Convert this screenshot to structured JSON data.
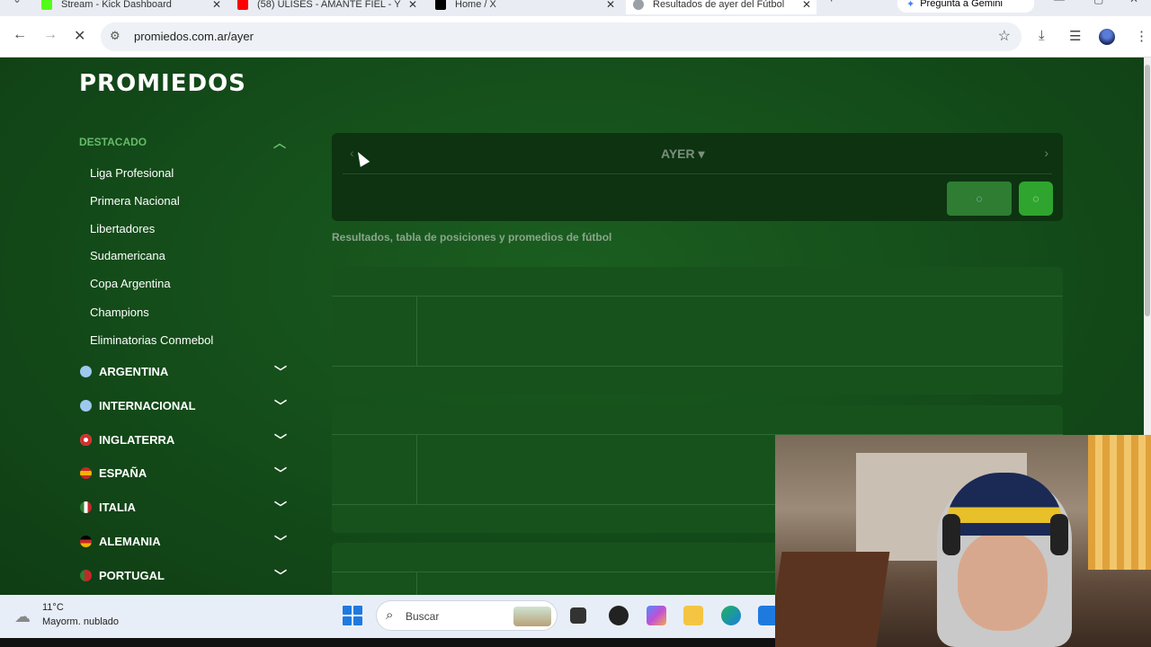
{
  "browser": {
    "tabs": [
      {
        "title": "Stream - Kick Dashboard",
        "color": "#53fc18"
      },
      {
        "title": "(58) ULISES - AMANTE FIEL - Y",
        "color": "#ff0000"
      },
      {
        "title": "Home / X",
        "color": "#000000"
      },
      {
        "title": "Resultados de ayer del Fútbol",
        "color": "#5f6368"
      }
    ],
    "gemini_label": "Pregunta a Gemini",
    "url": "promiedos.com.ar/ayer"
  },
  "site": {
    "logo": "PROMIEDOS",
    "sidebar": {
      "section_title": "DESTACADO",
      "items": [
        "Liga Profesional",
        "Primera Nacional",
        "Libertadores",
        "Sudamericana",
        "Copa Argentina",
        "Champions",
        "Eliminatorias Conmebol"
      ],
      "countries": [
        {
          "name": "ARGENTINA",
          "color": "#9ec9ef"
        },
        {
          "name": "INTERNACIONAL",
          "color": "#9ec9ef"
        },
        {
          "name": "INGLATERRA",
          "color": "#d32f2f"
        },
        {
          "name": "ESPAÑA",
          "color": "#f4b400"
        },
        {
          "name": "ITALIA",
          "color": "#2e7d32"
        },
        {
          "name": "ALEMANIA",
          "color": "#f4b400"
        },
        {
          "name": "PORTUGAL",
          "color": "#c62828"
        }
      ]
    },
    "date_nav": {
      "label": "AYER"
    },
    "subtitle": "Resultados, tabla de posiciones y promedios de fútbol"
  },
  "taskbar": {
    "temp": "11°C",
    "weather": "Mayorm. nublado",
    "search_placeholder": "Buscar"
  }
}
